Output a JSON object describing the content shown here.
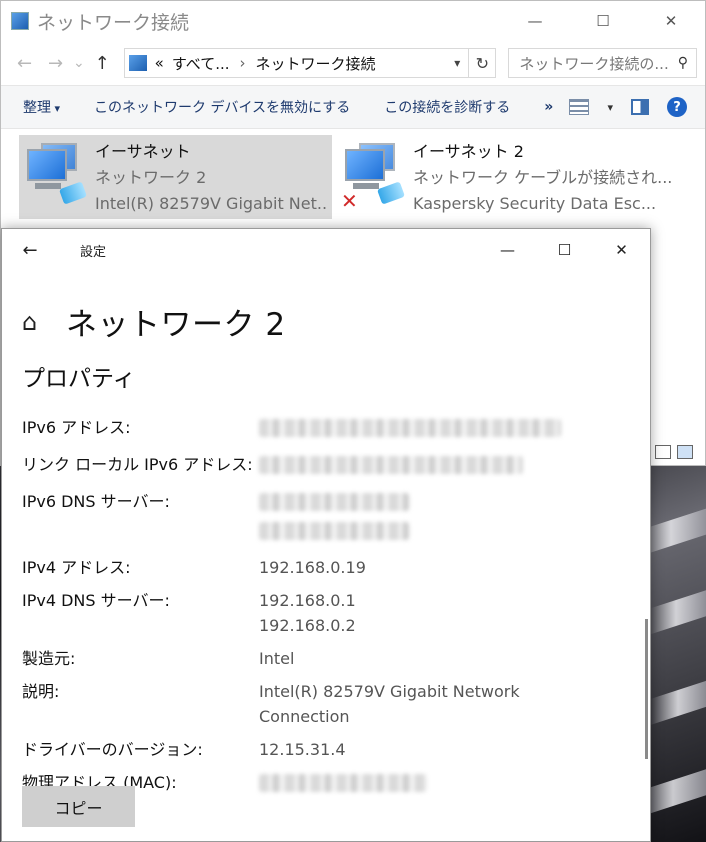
{
  "explorer": {
    "title": "ネットワーク接続",
    "caption": {
      "minimize": "—",
      "maximize": "☐",
      "close": "✕"
    },
    "nav": {
      "back": "←",
      "forward": "→",
      "recent": "⌄",
      "up": "↑"
    },
    "address": {
      "overflow": "«",
      "crumbs": [
        "すべて...",
        "ネットワーク接続"
      ],
      "separator": "›"
    },
    "search_placeholder": "ネットワーク接続の...",
    "commands": [
      {
        "label": "整理"
      },
      {
        "label": "このネットワーク デバイスを無効にする"
      },
      {
        "label": "この接続を診断する"
      },
      {
        "label": "»"
      }
    ],
    "help": "?",
    "adapters": [
      {
        "name": "イーサネット",
        "network": "ネットワーク 2",
        "device": "Intel(R) 82579V Gigabit Net...",
        "selected": true
      },
      {
        "name": "イーサネット 2",
        "network": "ネットワーク ケーブルが接続され...",
        "device": "Kaspersky Security Data Esc...",
        "selected": false
      }
    ]
  },
  "settings": {
    "title": "設定",
    "back": "←",
    "caption": {
      "minimize": "—",
      "maximize": "☐",
      "close": "✕"
    },
    "heading": "ネットワーク 2",
    "section": "プロパティ",
    "properties": [
      {
        "label": "IPv6 アドレス:",
        "values": [],
        "redacted": true
      },
      {
        "label": "リンク ローカル IPv6 アドレス:",
        "values": [],
        "redacted": true
      },
      {
        "label": "IPv6 DNS サーバー:",
        "values": [],
        "redacted": true
      },
      {
        "label": "IPv4 アドレス:",
        "values": [
          "192.168.0.19"
        ]
      },
      {
        "label": "IPv4 DNS サーバー:",
        "values": [
          "192.168.0.1",
          "192.168.0.2"
        ]
      },
      {
        "label": "製造元:",
        "values": [
          "Intel"
        ]
      },
      {
        "label": "説明:",
        "values": [
          "Intel(R) 82579V Gigabit Network",
          "Connection"
        ]
      },
      {
        "label": "ドライバーのバージョン:",
        "values": [
          "12.15.31.4"
        ]
      },
      {
        "label": "物理アドレス (MAC):",
        "values": [],
        "redacted": true
      }
    ],
    "copy_label": "コピー"
  }
}
